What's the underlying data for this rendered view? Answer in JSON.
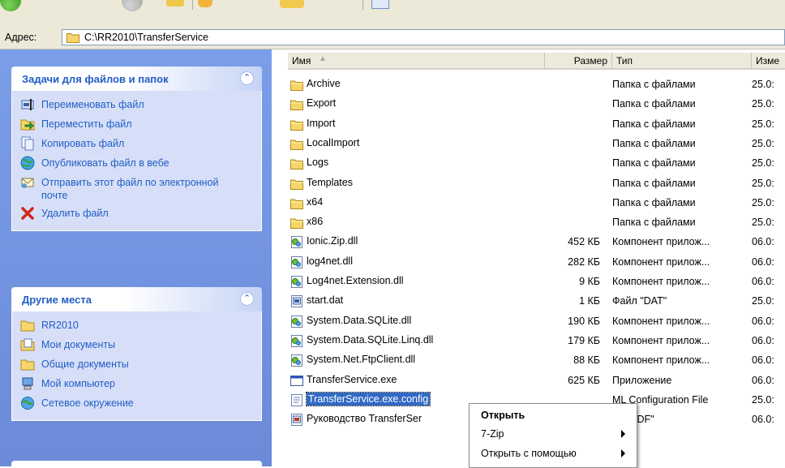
{
  "address": {
    "label": "Адрес:",
    "path": "C:\\RR2010\\TransferService"
  },
  "tasks_panel": {
    "title": "Задачи для файлов и папок",
    "items": [
      {
        "label": "Переименовать файл",
        "icon": "rename-icon"
      },
      {
        "label": "Переместить файл",
        "icon": "move-icon"
      },
      {
        "label": "Копировать файл",
        "icon": "copy-icon"
      },
      {
        "label": "Опубликовать файл в вебе",
        "icon": "publish-web-icon"
      },
      {
        "label": "Отправить этот файл по электронной почте",
        "icon": "email-icon"
      },
      {
        "label": "Удалить файл",
        "icon": "delete-icon"
      }
    ]
  },
  "places_panel": {
    "title": "Другие места",
    "items": [
      {
        "label": "RR2010",
        "icon": "folder-icon"
      },
      {
        "label": "Мои документы",
        "icon": "my-documents-icon"
      },
      {
        "label": "Общие документы",
        "icon": "folder-icon"
      },
      {
        "label": "Мой компьютер",
        "icon": "my-computer-icon"
      },
      {
        "label": "Сетевое окружение",
        "icon": "network-icon"
      }
    ]
  },
  "columns": {
    "name": "Имя",
    "size": "Размер",
    "type": "Тип",
    "date": "Изме"
  },
  "files": [
    {
      "name": "Archive",
      "size": "",
      "type": "Папка с файлами",
      "date": "25.0:",
      "icon": "folder-icon"
    },
    {
      "name": "Export",
      "size": "",
      "type": "Папка с файлами",
      "date": "25.0:",
      "icon": "folder-icon"
    },
    {
      "name": "Import",
      "size": "",
      "type": "Папка с файлами",
      "date": "25.0:",
      "icon": "folder-icon"
    },
    {
      "name": "LocalImport",
      "size": "",
      "type": "Папка с файлами",
      "date": "25.0:",
      "icon": "folder-icon"
    },
    {
      "name": "Logs",
      "size": "",
      "type": "Папка с файлами",
      "date": "25.0:",
      "icon": "folder-icon"
    },
    {
      "name": "Templates",
      "size": "",
      "type": "Папка с файлами",
      "date": "25.0:",
      "icon": "folder-icon"
    },
    {
      "name": "x64",
      "size": "",
      "type": "Папка с файлами",
      "date": "25.0:",
      "icon": "folder-icon"
    },
    {
      "name": "x86",
      "size": "",
      "type": "Папка с файлами",
      "date": "25.0:",
      "icon": "folder-icon"
    },
    {
      "name": "Ionic.Zip.dll",
      "size": "452 КБ",
      "type": "Компонент прилож...",
      "date": "06.0:",
      "icon": "dll-icon"
    },
    {
      "name": "log4net.dll",
      "size": "282 КБ",
      "type": "Компонент прилож...",
      "date": "06.0:",
      "icon": "dll-icon"
    },
    {
      "name": "Log4net.Extension.dll",
      "size": "9 КБ",
      "type": "Компонент прилож...",
      "date": "06.0:",
      "icon": "dll-icon"
    },
    {
      "name": "start.dat",
      "size": "1 КБ",
      "type": "Файл \"DAT\"",
      "date": "25.0:",
      "icon": "dat-file-icon"
    },
    {
      "name": "System.Data.SQLite.dll",
      "size": "190 КБ",
      "type": "Компонент прилож...",
      "date": "06.0:",
      "icon": "dll-icon"
    },
    {
      "name": "System.Data.SQLite.Linq.dll",
      "size": "179 КБ",
      "type": "Компонент прилож...",
      "date": "06.0:",
      "icon": "dll-icon"
    },
    {
      "name": "System.Net.FtpClient.dll",
      "size": "88 КБ",
      "type": "Компонент прилож...",
      "date": "06.0:",
      "icon": "dll-icon"
    },
    {
      "name": "TransferService.exe",
      "size": "625 КБ",
      "type": "Приложение",
      "date": "06.0:",
      "icon": "exe-icon"
    },
    {
      "name": "TransferService.exe.config",
      "size": "",
      "type": "ML Configuration File",
      "date": "25.0:",
      "icon": "config-file-icon",
      "selected": true
    },
    {
      "name": "Руководство TransferSer",
      "size": "",
      "type": "йл \"PDF\"",
      "date": "06.0:",
      "icon": "pdf-file-icon"
    }
  ],
  "context_menu": {
    "items": [
      {
        "label": "Открыть",
        "default": true,
        "submenu": false
      },
      {
        "label": "7-Zip",
        "default": false,
        "submenu": true
      },
      {
        "label": "Открыть с помощью",
        "default": false,
        "submenu": true
      }
    ]
  },
  "colors": {
    "selection": "#316ac5",
    "task_link": "#215dc6",
    "pane": "#7b9ee8"
  }
}
